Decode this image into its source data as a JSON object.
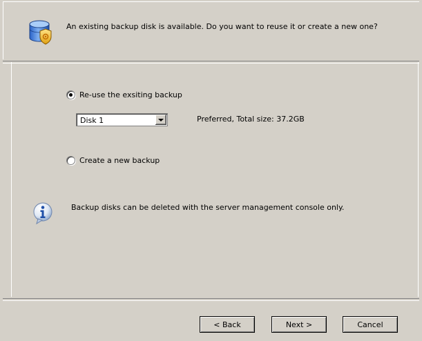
{
  "header": {
    "message": "An existing backup disk is available. Do you want to reuse it or create a new one?",
    "icon": "backup-disk-shield-icon"
  },
  "options": {
    "reuse_label": "Re-use the exsiting backup",
    "reuse_checked": true,
    "create_label": "Create a new backup",
    "create_checked": false
  },
  "disk_select": {
    "value": "Disk 1",
    "info": "Preferred, Total size: 37.2GB"
  },
  "info": {
    "icon": "info-icon",
    "text": "Backup disks can be deleted with the server management console only."
  },
  "buttons": {
    "back": "< Back",
    "next": "Next >",
    "cancel": "Cancel"
  },
  "colors": {
    "background": "#d4d0c8",
    "accent_blue": "#2b5fb4",
    "shield": "#f3c12a"
  }
}
